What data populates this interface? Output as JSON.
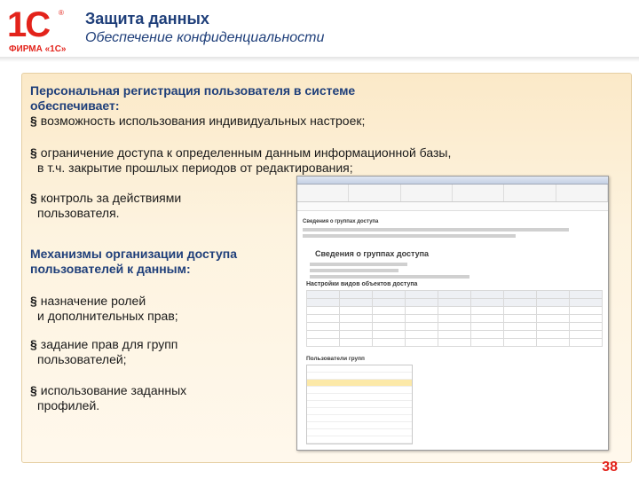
{
  "header": {
    "logo_mark": "1С",
    "logo_text": "ФИРМА «1С»",
    "title": "Защита данных",
    "subtitle": "Обеспечение конфиденциальности"
  },
  "content": {
    "intro_line1": "Персональная регистрация пользователя в системе",
    "intro_line2": "обеспечивает:",
    "bullets_a": [
      "возможность использования индивидуальных настроек;",
      "ограничение доступа к определенным данным информационной базы,",
      "в т.ч. закрытие прошлых периодов от редактирования;",
      "контроль за действиями",
      "пользователя."
    ],
    "mech_line1": "Механизмы организации доступа",
    "mech_line2": "пользователей к данным:",
    "bullets_b": [
      "назначение ролей",
      "и дополнительных прав;",
      "задание прав для групп",
      "пользователей;",
      "использование заданных",
      "профилей."
    ]
  },
  "screenshot": {
    "section_groups": "Сведения о группах доступа",
    "section_settings": "Настройки видов объектов доступа",
    "section_users": "Пользователи групп"
  },
  "page_number": "38"
}
